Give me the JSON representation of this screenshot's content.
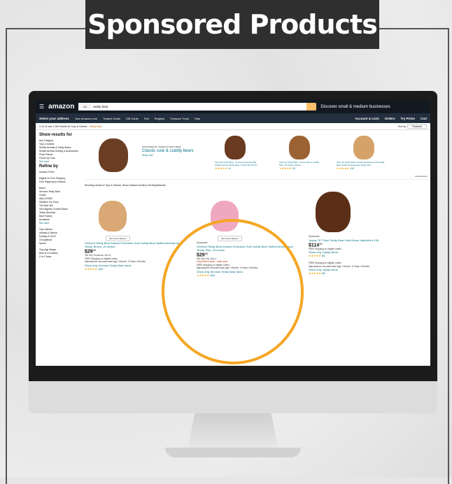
{
  "banner": {
    "title": "Sponsored Products"
  },
  "header": {
    "logo": "amazon",
    "search_category": "All",
    "search_query": "teddy bear",
    "promo": "Discover small & medium businesses"
  },
  "nav": {
    "deliver": "Select your address",
    "links": [
      "Your Amazon.com",
      "Today's Deals",
      "Gift Cards",
      "Sell",
      "Registry",
      "Treasure Truck",
      "Help"
    ],
    "account": "Account & Lists",
    "orders": "Orders",
    "prime": "Try Prime",
    "cart": "Cart"
  },
  "results_bar": {
    "summary": "1-24 of over 1,000 results for Toys & Games : ",
    "query": "\"teddy bear\"",
    "sort_label": "Sort by:",
    "sort_value": "Featured"
  },
  "sidebar": {
    "show_results": "Show results for",
    "categories": [
      "Any Category",
      "Toys & Games",
      "Stuffed Animals & Teddy Bears",
      "Stuffed Animal Clothing & Accessories",
      "Plush Pillows",
      "Grown-Up Toys",
      "See more"
    ],
    "refine": "Refine by",
    "amazon_prime": "Amazon Prime",
    "shipping_header": "Eligible for Free Shipping",
    "shipping_opt": "Free Shipping by Amazon",
    "brand_header": "Brand",
    "brands": [
      "Vermont Teddy Bear",
      "GUND",
      "WALLHOMO",
      "Stuffems Toy Shop",
      "The Bear Mill",
      "Gift Magnets Comfort Bears",
      "Teddy Mountain",
      "Bear Factory",
      "Annieland",
      "See more"
    ],
    "interest_header": "Toys Interest",
    "interests": [
      "Animals & Nature",
      "Fantasy & Sci-Fi",
      "Occupations",
      "Sports"
    ],
    "age_header": "Toys Age Range",
    "ages": [
      "Birth to 24 Months",
      "2 to 4 Years"
    ]
  },
  "headline_ad": {
    "sponsored_by": "SPONSORED BY VERMONT TEDDY BEAR",
    "headline": "Classic cute & cuddly bears",
    "cta": "Shop now",
    "products": [
      {
        "title": "Vermont Teddy Bear - Amazon Exclusive Big Stuffed Animal Teddy Bear, 3 Feet Tall, Brown",
        "reviews": "41"
      },
      {
        "title": "Vermont Teddy Bear - Fuzzy Soft & Cuddly Bear, 18 Inches, Brown",
        "reviews": "93"
      },
      {
        "title": "Vermont Teddy Bear Amazon Exclusive Soft Cuddly Bear Stuffed Animals and Teddy, Bro...",
        "reviews": "139"
      }
    ],
    "advertisement": "Advertisement"
  },
  "results_note": "Showing results in Toys & Games. Show instead results in All Departments.",
  "products": [
    {
      "options": "See Color Options",
      "sponsored": "",
      "title": "Vermont Teddy Bear Amazon Exclusive Soft Cuddly Bear Stuffed Animals and Teddy, Brown, 15 Inches",
      "price": "$29",
      "price_cents": "95",
      "delivery": "Get it by Tomorrow, Oct 31",
      "stock": "",
      "shipping": "FREE Shipping on eligible orders",
      "age": "Manufacturer recommended age: 0 Month - 8 Years 4 Months",
      "more": "Show only Vermont Teddy Bear items",
      "reviews": "168"
    },
    {
      "options": "See Color Options",
      "sponsored": "Sponsored",
      "title": "Vermont Teddy Bear Amazon Exclusive Soft Cuddly Bear Stuffed Animals and Teddy, Pink, 15 Inches",
      "price": "$29",
      "price_cents": "95",
      "delivery": "Get it by Thu, Nov 1",
      "stock": "Only 8 left in stock - order soon.",
      "shipping": "FREE Shipping on eligible orders",
      "age": "Manufacturer recommended age: 0 Month - 8 Years 4 Months",
      "more": "Show only Vermont Teddy Bear items",
      "reviews": "168"
    },
    {
      "options": "",
      "sponsored": "Sponsored",
      "title": "Joyfay 78\" Giant Teddy Bear Dark Brown Valentine's Gift",
      "price": "$114",
      "price_cents": "99",
      "delivery": "",
      "stock": "",
      "shipping": "FREE Shipping on eligible orders",
      "age": "Manufacturer recommended age: 0 Month - 8 Years 4 Months",
      "more": "Show only Joyfay items",
      "reviews": "88"
    }
  ],
  "colors": {
    "header_bg": "#131921",
    "nav_bg": "#232f3e",
    "highlight_circle": "#f5a623",
    "link": "#007185"
  }
}
